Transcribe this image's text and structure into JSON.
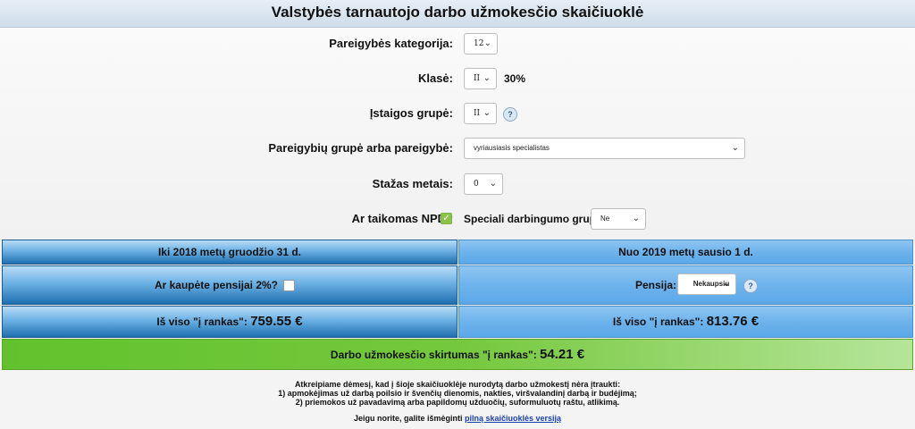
{
  "header": {
    "title": "Valstybės tarnautojo darbo užmokesčio skaičiuoklė"
  },
  "form": {
    "category": {
      "label": "Pareigybės kategorija:",
      "value": "12"
    },
    "class": {
      "label": "Klasė:",
      "value": "II",
      "percent": "30%"
    },
    "institution_group": {
      "label": "Įstaigos grupė:",
      "value": "II"
    },
    "position_group": {
      "label": "Pareigybių grupė arba pareigybė:",
      "value": "vyriausiasis specialistas"
    },
    "experience": {
      "label": "Stažas metais:",
      "value": "0"
    },
    "npd": {
      "label": "Ar taikomas NPD?",
      "checked": true
    },
    "special_group": {
      "label": "Speciali darbingumo grupė",
      "value": "Ne"
    }
  },
  "panels": {
    "left": {
      "title": "Iki 2018 metų gruodžio 31 d.",
      "pension_label": "Ar kaupėte pensijai 2%?",
      "pension_checked": false,
      "total_label": "Iš viso \"į rankas\":",
      "total_value": "759.55 €"
    },
    "right": {
      "title": "Nuo 2019 metų sausio 1 d.",
      "pension_label": "Pensija:",
      "pension_value": "Nekaupsiu",
      "total_label": "Iš viso \"į rankas\":",
      "total_value": "813.76 €"
    }
  },
  "difference": {
    "label": "Darbo užmokesčio skirtumas \"į rankas\":",
    "value": "54.21 €"
  },
  "notes": {
    "line1": "Atkreipiame dėmesį, kad į šioje skaičiuoklėje nurodytą darbo užmokestį nėra įtraukti:",
    "line2": "1) apmokėjimas už darbą poilsio ir švenčių dienomis, nakties, viršvalandinį darbą ir budėjimą;",
    "line3": "2) priemokos už pavadavimą arba papildomų užduočių, suformuluotų raštu, atlikimą.",
    "full_version_prefix": "Jeigu norite, galite išmėginti",
    "full_version_link": "pilną skaičiuoklės versiją"
  },
  "icons": {
    "help": "question-icon",
    "chevron": "chevron-down-icon",
    "check": "checkmark-icon"
  },
  "colors": {
    "accent_blue": "#1f6fb0",
    "light_blue": "#6db3ec",
    "green": "#62c22d",
    "link": "#1a3fb5"
  }
}
